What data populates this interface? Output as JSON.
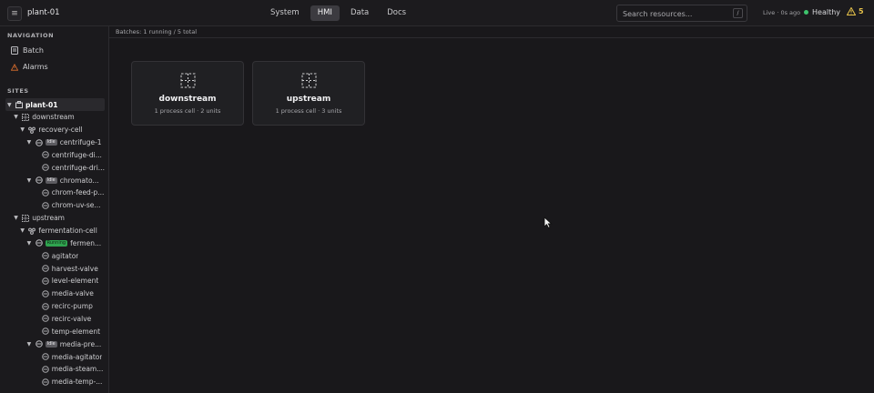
{
  "app": {
    "title": "plant-01",
    "menu_icon": "hamburger-icon"
  },
  "nav": {
    "tabs": [
      {
        "label": "System",
        "active": false
      },
      {
        "label": "HMI",
        "active": true
      },
      {
        "label": "Data",
        "active": false
      },
      {
        "label": "Docs",
        "active": false
      }
    ]
  },
  "search": {
    "placeholder": "Search resources...",
    "shortcut": "/"
  },
  "status": {
    "live": "Live · 0s ago",
    "health": "Healthy",
    "health_color": "#3ec46d",
    "alert_count": "5",
    "alert_color": "#e8c34a"
  },
  "sidebar": {
    "navigation_label": "NAVIGATION",
    "links": [
      {
        "label": "Batch",
        "icon": "clipboard-icon"
      },
      {
        "label": "Alarms",
        "icon": "warning-icon"
      }
    ],
    "sites_label": "SITES",
    "tree": [
      {
        "label": "plant-01",
        "level": 0,
        "caret": "▼",
        "icon": "site",
        "selected": true
      },
      {
        "label": "downstream",
        "level": 1,
        "caret": "▼",
        "icon": "area"
      },
      {
        "label": "recovery-cell",
        "level": 2,
        "caret": "▼",
        "icon": "cell"
      },
      {
        "label": "centrifuge-1",
        "level": 3,
        "caret": "▼",
        "icon": "unit",
        "badge": "Idle"
      },
      {
        "label": "centrifuge-di...",
        "level": 4,
        "icon": "module"
      },
      {
        "label": "centrifuge-dri...",
        "level": 4,
        "icon": "module"
      },
      {
        "label": "chromato...",
        "level": 3,
        "caret": "▼",
        "icon": "unit",
        "badge": "Idle"
      },
      {
        "label": "chrom-feed-p...",
        "level": 4,
        "icon": "module"
      },
      {
        "label": "chrom-uv-se...",
        "level": 4,
        "icon": "module"
      },
      {
        "label": "upstream",
        "level": 1,
        "caret": "▼",
        "icon": "area"
      },
      {
        "label": "fermentation-cell",
        "level": 2,
        "caret": "▼",
        "icon": "cell"
      },
      {
        "label": "fermen...",
        "level": 3,
        "caret": "▼",
        "icon": "unit",
        "badge": "Running",
        "badge_running": true
      },
      {
        "label": "agitator",
        "level": 4,
        "icon": "module"
      },
      {
        "label": "harvest-valve",
        "level": 4,
        "icon": "module"
      },
      {
        "label": "level-element",
        "level": 4,
        "icon": "module"
      },
      {
        "label": "media-valve",
        "level": 4,
        "icon": "module"
      },
      {
        "label": "recirc-pump",
        "level": 4,
        "icon": "module"
      },
      {
        "label": "recirc-valve",
        "level": 4,
        "icon": "module"
      },
      {
        "label": "temp-element",
        "level": 4,
        "icon": "module"
      },
      {
        "label": "media-pre...",
        "level": 3,
        "caret": "▼",
        "icon": "unit",
        "badge": "Idle"
      },
      {
        "label": "media-agitator",
        "level": 4,
        "icon": "module"
      },
      {
        "label": "media-steam...",
        "level": 4,
        "icon": "module"
      },
      {
        "label": "media-temp-...",
        "level": 4,
        "icon": "module"
      }
    ]
  },
  "main": {
    "batch_summary": "Batches: 1 running / 5 total",
    "cards": [
      {
        "title": "downstream",
        "subtitle": "1 process cell · 2 units",
        "icon": "area-icon"
      },
      {
        "title": "upstream",
        "subtitle": "1 process cell · 3 units",
        "icon": "area-icon"
      }
    ]
  }
}
